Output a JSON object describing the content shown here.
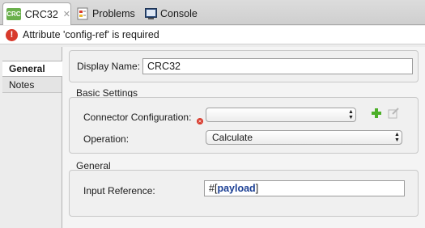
{
  "tabs": {
    "active": {
      "badge": "CRC",
      "label": "CRC32",
      "close": "✕"
    },
    "problems": {
      "label": "Problems"
    },
    "console": {
      "label": "Console"
    }
  },
  "error": {
    "message": "Attribute 'config-ref' is required",
    "icon": "!"
  },
  "left_tabs": [
    {
      "label": "General"
    },
    {
      "label": "Notes"
    }
  ],
  "form": {
    "display_name": {
      "label": "Display Name:",
      "value": "CRC32"
    },
    "basic_settings": {
      "title": "Basic Settings",
      "connector_configuration": {
        "label": "Connector Configuration:",
        "value": ""
      },
      "operation": {
        "label": "Operation:",
        "value": "Calculate"
      }
    },
    "general": {
      "title": "General",
      "input_reference": {
        "label": "Input Reference:",
        "prefix": "#[",
        "keyword": "payload",
        "suffix": "]"
      }
    }
  },
  "colors": {
    "badge": "#6ab04c",
    "error": "#d83a2c",
    "add": "#4caf28",
    "keyword": "#1b3f94"
  }
}
